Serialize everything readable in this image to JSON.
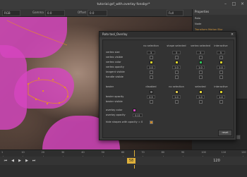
{
  "app": {
    "title": "tutorial.gsf_with.overlay fonsbyr*"
  },
  "viewer_bar": {
    "channel": "RGB",
    "layer_label": "Gamma",
    "gamma_value": "0.0",
    "offset_label": "Offset",
    "offset_value": "0.0",
    "view_label": "Full"
  },
  "right_panel": {
    "header": "Properties",
    "rows": [
      "Roto",
      "Node",
      "Transform  Motion Blur",
      "Opacity",
      "",
      "",
      "",
      ""
    ]
  },
  "dialog": {
    "title": "Roto tool_Overlay",
    "columns": [
      "no selection",
      "shape selected",
      "vertex selected",
      "interactive"
    ],
    "vertex_rows": [
      {
        "label": "vertex size",
        "values": [
          "3",
          "3",
          "3",
          "5"
        ]
      },
      {
        "label": "vertex visible",
        "swatches": [
          "#2a2a2a",
          "#2a2a2a",
          "#2a2a2a",
          "#2a2a2a"
        ],
        "checks": true
      },
      {
        "label": "vertex color",
        "swatches": [
          "#d9d02c",
          "#d9d02c",
          "#30c05a",
          "#d9d02c"
        ]
      },
      {
        "label": "vertex opacity",
        "values": [
          "1.0",
          "1.0",
          "1.0",
          "1.0"
        ]
      },
      {
        "label": "tangent visible",
        "checks": true
      },
      {
        "label": "handle visible",
        "checks": true
      }
    ],
    "bezier_columns": [
      "disabled",
      "no selection",
      "selected",
      "interactive"
    ],
    "bezier_rows": [
      {
        "label": "bezier",
        "swatches": [
          "#6a6a6a",
          "#d9c24a",
          "#e0d13a",
          "#d9d02c"
        ]
      },
      {
        "label": "bezier opacity",
        "values": [
          "0.5",
          "1.0",
          "1.0",
          "1.0"
        ]
      },
      {
        "label": "bezier visible",
        "checks": true
      }
    ],
    "overlay_color_label": "overlay color",
    "overlay_color": "#d646c0",
    "overlay_opacity_label": "overlay opacity",
    "overlay_opacity": "0.11",
    "hide_label": "hide shapes with opacity = 0",
    "reset_label": "reset"
  },
  "coords": "X: 0  Y: 2715  R: 0.1779  G: 0.2031  B: 0.1563  A: 0.0000",
  "timeline": {
    "ticks": [
      "1",
      "10",
      "20",
      "30",
      "40",
      "50",
      "60",
      "70",
      "80",
      "90",
      "100",
      "110",
      "120"
    ],
    "playhead_frame": "58",
    "start_frame": "1",
    "end_frame": "120"
  },
  "colors": {
    "accent": "#e0b13a",
    "overlay": "#d646c0",
    "keyframe": "#4fb0e0"
  }
}
